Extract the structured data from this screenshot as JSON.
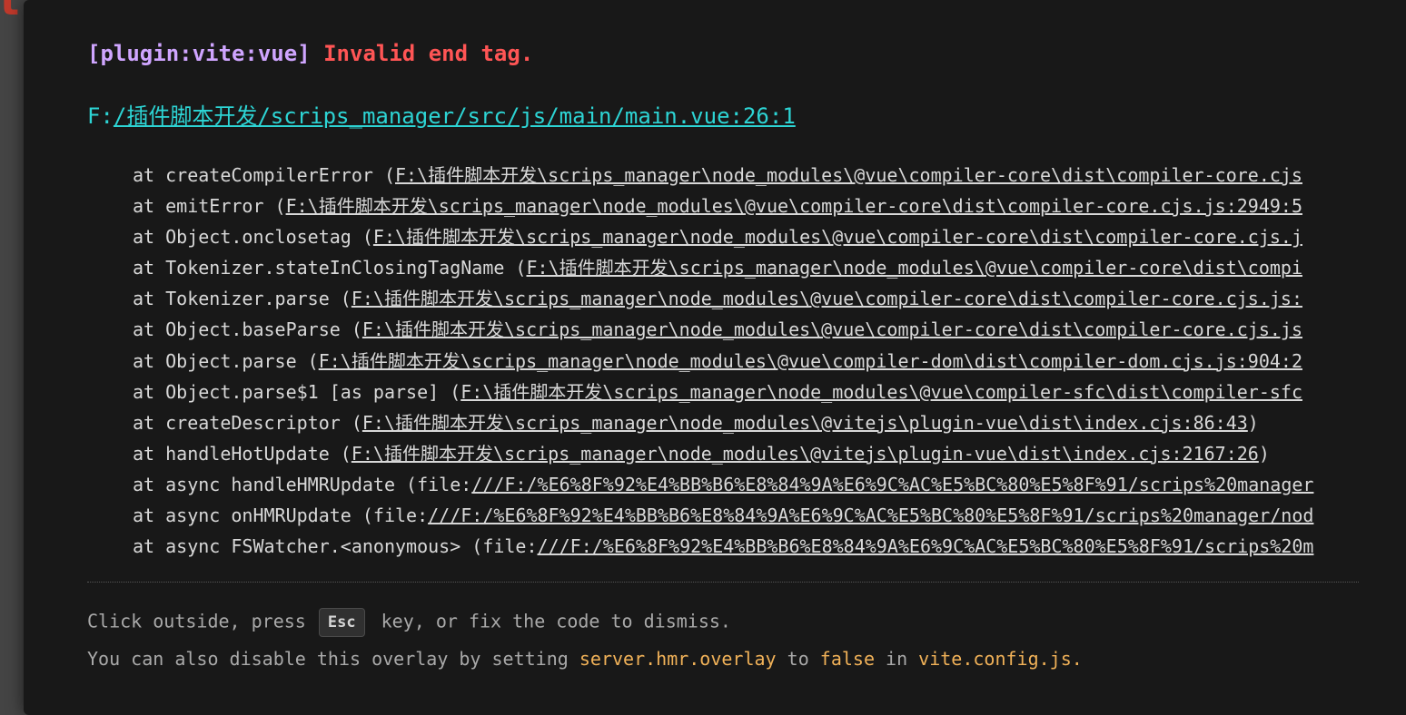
{
  "error": {
    "plugin": "[plugin:vite:vue]",
    "message": "Invalid end tag.",
    "file_prefix": "F:",
    "file_link": "/插件脚本开发/scrips_manager/src/js/main/main.vue:26:1"
  },
  "stack": [
    {
      "prefix": "at createCompilerError (",
      "location": "F:\\插件脚本开发\\scrips_manager\\node_modules\\@vue\\compiler-core\\dist\\compiler-core.cjs",
      "suffix": ""
    },
    {
      "prefix": "at emitError (",
      "location": "F:\\插件脚本开发\\scrips_manager\\node_modules\\@vue\\compiler-core\\dist\\compiler-core.cjs.js:2949:5",
      "suffix": ""
    },
    {
      "prefix": "at Object.onclosetag (",
      "location": "F:\\插件脚本开发\\scrips_manager\\node_modules\\@vue\\compiler-core\\dist\\compiler-core.cjs.j",
      "suffix": ""
    },
    {
      "prefix": "at Tokenizer.stateInClosingTagName (",
      "location": "F:\\插件脚本开发\\scrips_manager\\node_modules\\@vue\\compiler-core\\dist\\compi",
      "suffix": ""
    },
    {
      "prefix": "at Tokenizer.parse (",
      "location": "F:\\插件脚本开发\\scrips_manager\\node_modules\\@vue\\compiler-core\\dist\\compiler-core.cjs.js:",
      "suffix": ""
    },
    {
      "prefix": "at Object.baseParse (",
      "location": "F:\\插件脚本开发\\scrips_manager\\node_modules\\@vue\\compiler-core\\dist\\compiler-core.cjs.js",
      "suffix": ""
    },
    {
      "prefix": "at Object.parse (",
      "location": "F:\\插件脚本开发\\scrips_manager\\node_modules\\@vue\\compiler-dom\\dist\\compiler-dom.cjs.js:904:2",
      "suffix": ""
    },
    {
      "prefix": "at Object.parse$1 [as parse] (",
      "location": "F:\\插件脚本开发\\scrips_manager\\node_modules\\@vue\\compiler-sfc\\dist\\compiler-sfc",
      "suffix": ""
    },
    {
      "prefix": "at createDescriptor (",
      "location": "F:\\插件脚本开发\\scrips_manager\\node_modules\\@vitejs\\plugin-vue\\dist\\index.cjs:86:43",
      "suffix": ")"
    },
    {
      "prefix": "at handleHotUpdate (",
      "location": "F:\\插件脚本开发\\scrips_manager\\node_modules\\@vitejs\\plugin-vue\\dist\\index.cjs:2167:26",
      "suffix": ")"
    },
    {
      "prefix": "at async handleHMRUpdate (file:",
      "location": "///F:/%E6%8F%92%E4%BB%B6%E8%84%9A%E6%9C%AC%E5%BC%80%E5%8F%91/scrips%20manager",
      "suffix": ""
    },
    {
      "prefix": "at async onHMRUpdate (file:",
      "location": "///F:/%E6%8F%92%E4%BB%B6%E8%84%9A%E6%9C%AC%E5%BC%80%E5%8F%91/scrips%20manager/nod",
      "suffix": ""
    },
    {
      "prefix": "at async FSWatcher.<anonymous> (file:",
      "location": "///F:/%E6%8F%92%E4%BB%B6%E8%84%9A%E6%9C%AC%E5%BC%80%E5%8F%91/scrips%20m",
      "suffix": ""
    }
  ],
  "tip": {
    "line1_before": "Click outside, press ",
    "key": "Esc",
    "line1_after": " key, or fix the code to dismiss.",
    "line2_a": "You can also disable this overlay by setting ",
    "line2_code1": "server.hmr.overlay",
    "line2_b": " to ",
    "line2_code2": "false",
    "line2_c": " in ",
    "line2_code3": "vite.config.js."
  },
  "colors": {
    "plugin": "#cfa5ff",
    "message": "#ff5555",
    "file": "#2dd4d4",
    "code_highlight": "#f0b158",
    "window_bg": "#181818"
  }
}
